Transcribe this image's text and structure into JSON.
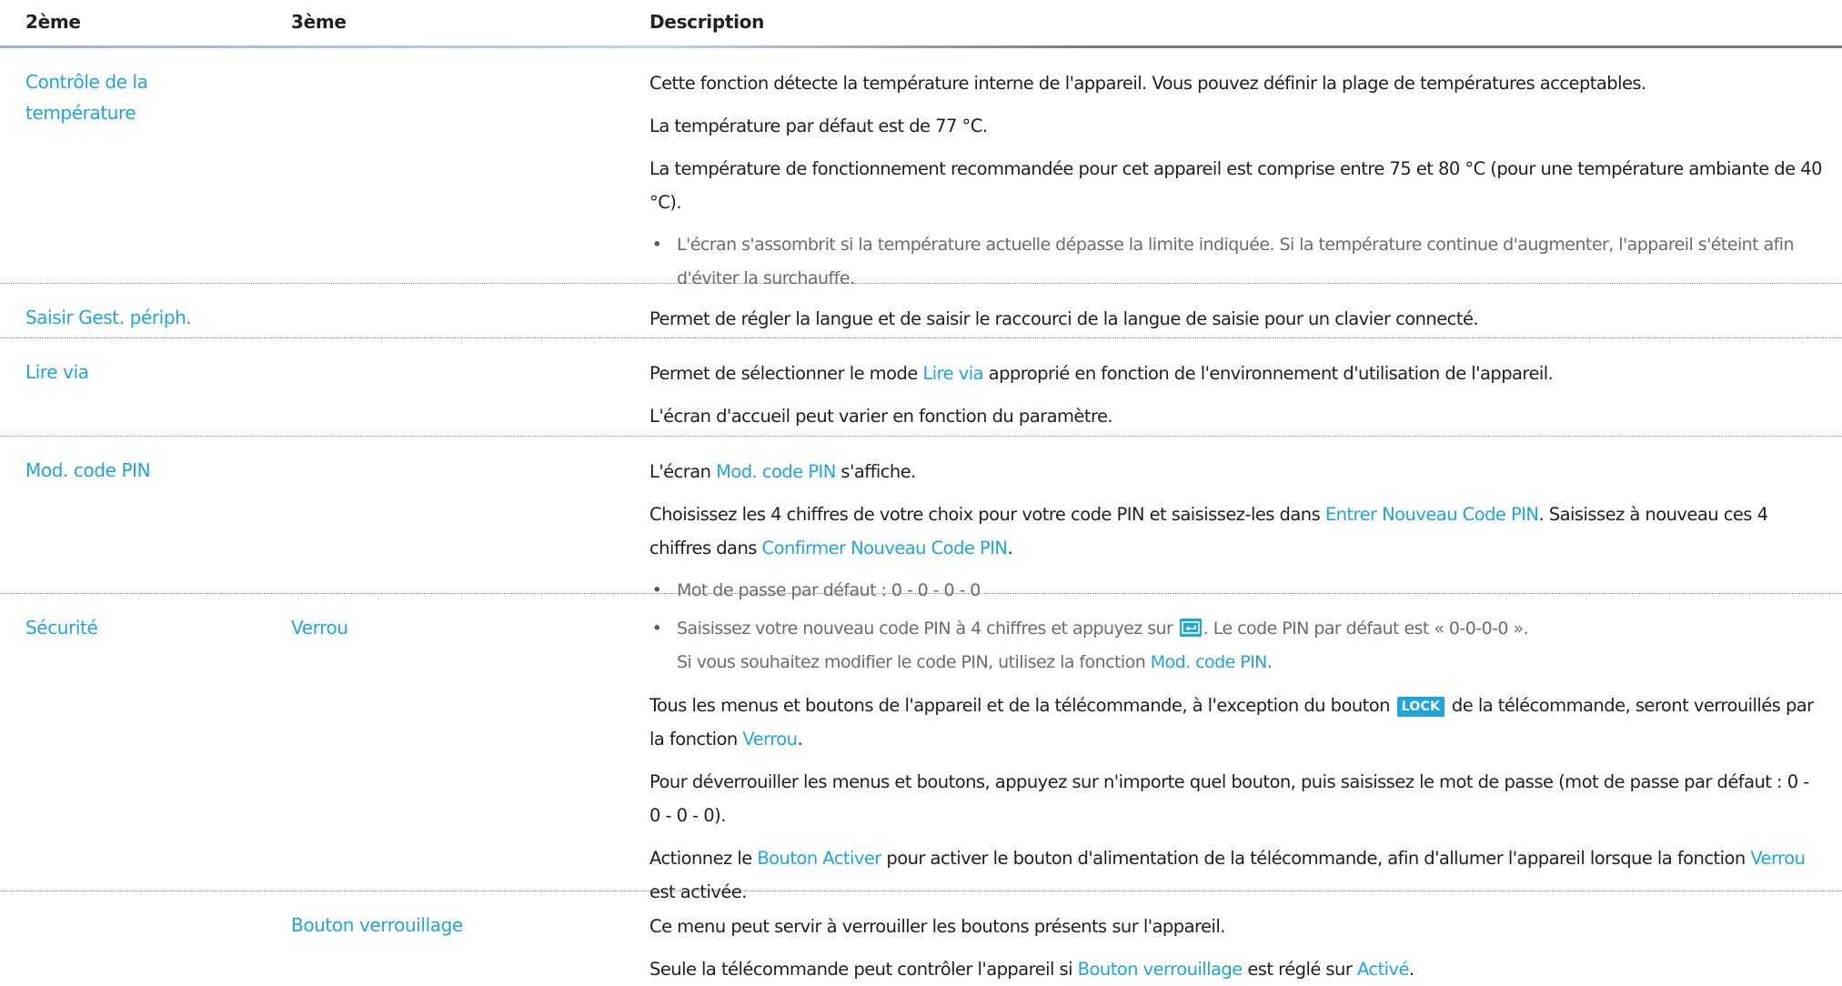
{
  "header": {
    "col1": "2ème",
    "col2": "3ème",
    "col3": "Description"
  },
  "rows": [
    {
      "menu": "Contrôle de la température",
      "desc": [
        "Cette fonction détecte la température interne de l'appareil. Vous pouvez définir la plage de températures acceptables.",
        "La température par défaut est de 77 °C.",
        "La température de fonctionnement recommandée pour cet appareil est comprise entre 75 et 80 °C (pour une température ambiante de 40 °C)."
      ],
      "note": "L'écran s'assombrit si la température actuelle dépasse la limite indiquée. Si la température continue d'augmenter, l'appareil s'éteint afin d'éviter la surchauffe."
    },
    {
      "menu": "Saisir Gest. périph.",
      "desc": [
        "Permet de régler la langue et de saisir le raccourci de la langue de saisie pour un clavier connecté."
      ]
    },
    {
      "menu": "Lire via",
      "desc1": {
        "a": "Permet de sélectionner le mode ",
        "link": "Lire via",
        "b": " approprié en fonction de l'environnement d'utilisation de l'appareil."
      },
      "desc2": "L'écran d'accueil peut varier en fonction du paramètre."
    },
    {
      "menu": "Mod. code PIN",
      "desc1": {
        "a": "L'écran ",
        "link": "Mod. code PIN",
        "b": " s'affiche."
      },
      "desc2": {
        "a": "Choisissez les 4 chiffres de votre choix pour votre code PIN et saisissez-les dans ",
        "link1": "Entrer Nouveau Code PIN",
        "b": ". Saisissez à nouveau ces 4 chiffres dans ",
        "link2": "Confirmer Nouveau Code PIN",
        "c": "."
      },
      "note": "Mot de passe par défaut : 0 - 0 - 0 - 0"
    },
    {
      "menu": "Sécurité",
      "sub": "Verrou",
      "note": {
        "a": "Saisissez votre nouveau code PIN à 4 chiffres et appuyez sur ",
        "icon": "enter-icon",
        "b": ". Le code PIN par défaut est « 0-0-0-0 ».",
        "c": "Si vous souhaitez modifier le code PIN, utilisez la fonction ",
        "link": "Mod. code PIN",
        "d": "."
      },
      "p1": {
        "a": "Tous les menus et boutons de l'appareil et de la télécommande, à l'exception du bouton ",
        "key": "LOCK",
        "b": " de la télécommande, seront verrouillés par la fonction ",
        "link": "Verrou",
        "c": "."
      },
      "p2": "Pour déverrouiller les menus et boutons, appuyez sur n'importe quel bouton, puis saisissez le mot de passe (mot de passe par défaut : 0 - 0 - 0 - 0).",
      "p3": {
        "a": "Actionnez le ",
        "link1": "Bouton Activer",
        "b": " pour activer le bouton d'alimentation de la télécommande, afin d'allumer l'appareil lorsque la fonction ",
        "link2": "Verrou",
        "c": " est activée."
      }
    },
    {
      "sub": "Bouton verrouillage",
      "p1": "Ce menu peut servir à verrouiller les boutons présents sur l'appareil.",
      "p2": {
        "a": "Seule la télécommande peut contrôler l'appareil si ",
        "link1": "Bouton verrouillage",
        "b": " est réglé sur ",
        "link2": "Activé",
        "c": "."
      }
    }
  ],
  "colors": {
    "link": "#1ea6dc",
    "note_text": "#6b6b6b",
    "text": "#1f1f1f"
  }
}
